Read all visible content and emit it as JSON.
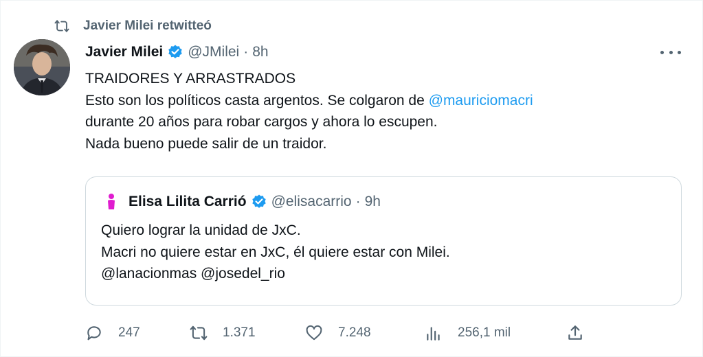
{
  "retweet": {
    "label": "Javier Milei retwitteó",
    "icon": "retweet-icon"
  },
  "tweet": {
    "author": {
      "name": "Javier Milei",
      "handle": "@JMilei",
      "time": "8h",
      "separator": "·",
      "verified": true
    },
    "lines": [
      {
        "text": "TRAIDORES Y ARRASTRADOS"
      },
      {
        "text": "Esto son los políticos casta argentos. Se colgaron de ",
        "mention": "@mauriciomacri"
      },
      {
        "text": "durante 20 años para robar cargos y ahora lo escupen."
      },
      {
        "text": "Nada bueno puede salir de un traidor."
      }
    ]
  },
  "quote": {
    "author": {
      "name": "Elisa Lilita Carrió",
      "handle": "@elisacarrio",
      "time": "9h",
      "separator": "·",
      "verified": true
    },
    "lines": [
      "Quiero lograr la unidad de JxC.",
      "Macri no quiere estar en JxC, él quiere estar con Milei.",
      "@lanacionmas @josedel_rio"
    ]
  },
  "actions": {
    "reply": {
      "count": "247",
      "icon": "reply-icon"
    },
    "retweet": {
      "count": "1.371",
      "icon": "retweet-icon"
    },
    "like": {
      "count": "7.248",
      "icon": "heart-icon"
    },
    "views": {
      "count": "256,1 mil",
      "icon": "views-icon"
    },
    "share": {
      "icon": "share-icon"
    }
  },
  "colors": {
    "accent": "#1d9bf0",
    "muted": "#536471",
    "text": "#0f1419",
    "border": "#cfd9de",
    "quote_avatar": "#e01ccf"
  }
}
